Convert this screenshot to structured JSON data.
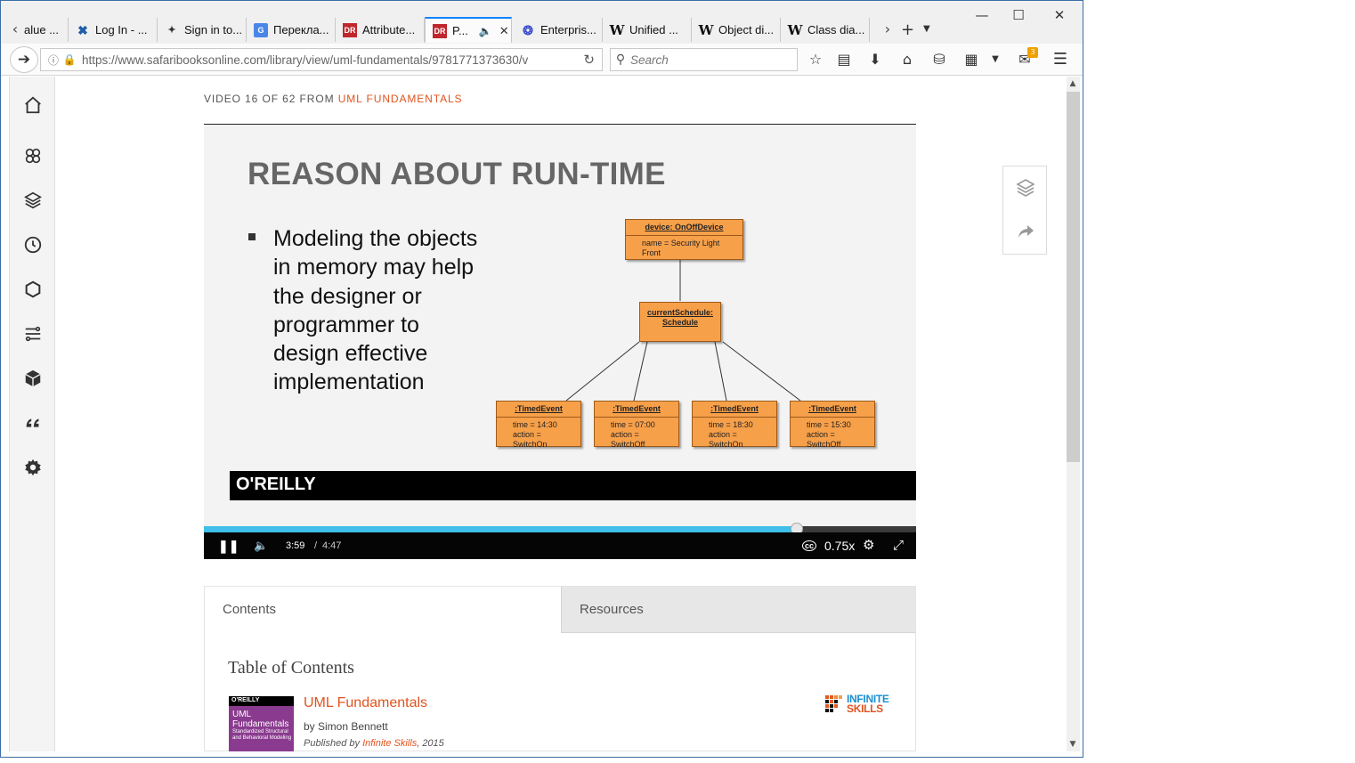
{
  "browser": {
    "tabs": [
      {
        "label": "alue ...",
        "icon": "wiki-icon"
      },
      {
        "label": "Log In - ...",
        "icon": "x-icon"
      },
      {
        "label": "Sign in to...",
        "icon": "tool-icon"
      },
      {
        "label": "Перекла...",
        "icon": "translate-icon"
      },
      {
        "label": "Attribute...",
        "icon": "dr-icon"
      },
      {
        "label": "P...",
        "icon": "dr-icon"
      },
      {
        "label": "Enterpris...",
        "icon": "enterprise-icon"
      },
      {
        "label": "Unified ...",
        "icon": "wiki-icon"
      },
      {
        "label": "Object di...",
        "icon": "wiki-icon"
      },
      {
        "label": "Class dia...",
        "icon": "wiki-icon"
      }
    ],
    "active_tab_index": 5,
    "url_host": "https://www.safaribooksonline.com",
    "url_path": "/library/view/uml-fundamentals/9781771373630/v",
    "search_placeholder": "Search",
    "notification_count": "3"
  },
  "page": {
    "breadcrumb_prefix": "VIDEO 16 OF 62 FROM ",
    "breadcrumb_link": "UML FUNDAMENTALS"
  },
  "slide": {
    "title": "REASON ABOUT RUN-TIME",
    "bullet": "Modeling the objects in memory may help the designer or programmer to design effective implementation",
    "footer_logo": "O'REILLY",
    "diagram": {
      "root": {
        "name": "device: OnOffDevice",
        "attr": "name = Security Light Front"
      },
      "middle": {
        "name": "currentSchedule: Schedule"
      },
      "events": [
        {
          "name": ":TimedEvent",
          "time": "time = 14:30",
          "action": "action = SwitchOn"
        },
        {
          "name": ":TimedEvent",
          "time": "time = 07:00",
          "action": "action = SwitchOff"
        },
        {
          "name": ":TimedEvent",
          "time": "time = 18:30",
          "action": "action = SwitchOn"
        },
        {
          "name": ":TimedEvent",
          "time": "time = 15:30",
          "action": "action = SwitchOff"
        }
      ]
    }
  },
  "player": {
    "current_time": "3:59",
    "separator": "/",
    "total_time": "4:47",
    "progress": 0.833,
    "speed": "0.75x",
    "colors": {
      "progress": "#40bfe9",
      "accent": "#e0531f"
    }
  },
  "tabs": {
    "contents_label": "Contents",
    "resources_label": "Resources"
  },
  "toc": {
    "heading": "Table of Contents",
    "book_title": "UML Fundamentals",
    "author": "by Simon Bennett",
    "published_prefix": "Published by",
    "publisher": "Infinite Skills",
    "published_year": ", 2015",
    "cover_brand": "O'REILLY",
    "cover_title_line1": "UML",
    "cover_title_line2": "Fundamentals",
    "cover_subtitle": "Standardized Structural and Behavioral Modeling",
    "publisher_logo_line1": "INFINITE",
    "publisher_logo_line2": "SKILLS"
  }
}
